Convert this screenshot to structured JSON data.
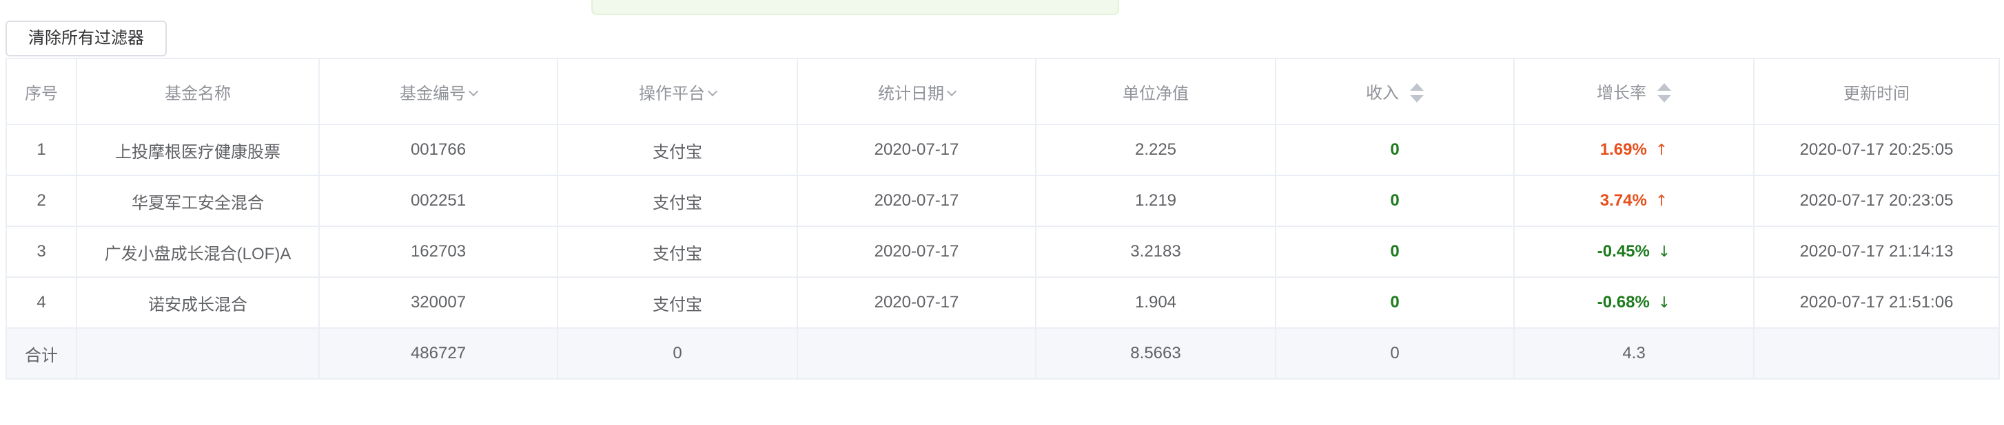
{
  "toolbar": {
    "clear_filters_label": "清除所有过滤器"
  },
  "table": {
    "headers": {
      "index": "序号",
      "fund_name": "基金名称",
      "fund_code": "基金编号",
      "platform": "操作平台",
      "stat_date": "统计日期",
      "nav": "单位净值",
      "income": "收入",
      "growth": "增长率",
      "updated": "更新时间"
    },
    "rows": [
      {
        "index": "1",
        "fund_name": "上投摩根医疗健康股票",
        "fund_code": "001766",
        "platform": "支付宝",
        "stat_date": "2020-07-17",
        "nav": "2.225",
        "income": "0",
        "growth": "1.69%",
        "growth_arrow": "↑",
        "updated": "2020-07-17 20:25:05"
      },
      {
        "index": "2",
        "fund_name": "华夏军工安全混合",
        "fund_code": "002251",
        "platform": "支付宝",
        "stat_date": "2020-07-17",
        "nav": "1.219",
        "income": "0",
        "growth": "3.74%",
        "growth_arrow": "↑",
        "updated": "2020-07-17 20:23:05"
      },
      {
        "index": "3",
        "fund_name": "广发小盘成长混合(LOF)A",
        "fund_code": "162703",
        "platform": "支付宝",
        "stat_date": "2020-07-17",
        "nav": "3.2183",
        "income": "0",
        "growth": "-0.45%",
        "growth_arrow": "↓",
        "updated": "2020-07-17 21:14:13"
      },
      {
        "index": "4",
        "fund_name": "诺安成长混合",
        "fund_code": "320007",
        "platform": "支付宝",
        "stat_date": "2020-07-17",
        "nav": "1.904",
        "income": "0",
        "growth": "-0.68%",
        "growth_arrow": "↓",
        "updated": "2020-07-17 21:51:06"
      }
    ],
    "footer": {
      "label": "合计",
      "fund_name": "",
      "fund_code": "486727",
      "platform": "0",
      "stat_date": "",
      "nav": "8.5663",
      "income": "0",
      "growth": "4.3",
      "updated": ""
    }
  },
  "colors": {
    "positive_growth": "#e6501e",
    "negative_growth": "#1e7b1e",
    "income": "#1e7b1e",
    "footer_bg": "#f5f7fa",
    "border": "#ebeef5",
    "alert_bg": "#f0f9eb"
  },
  "icons": {
    "filter_dropdown": "chevron-down-icon",
    "sort": "sort-caret-icon",
    "up": "arrow-up-icon",
    "down": "arrow-down-icon"
  }
}
